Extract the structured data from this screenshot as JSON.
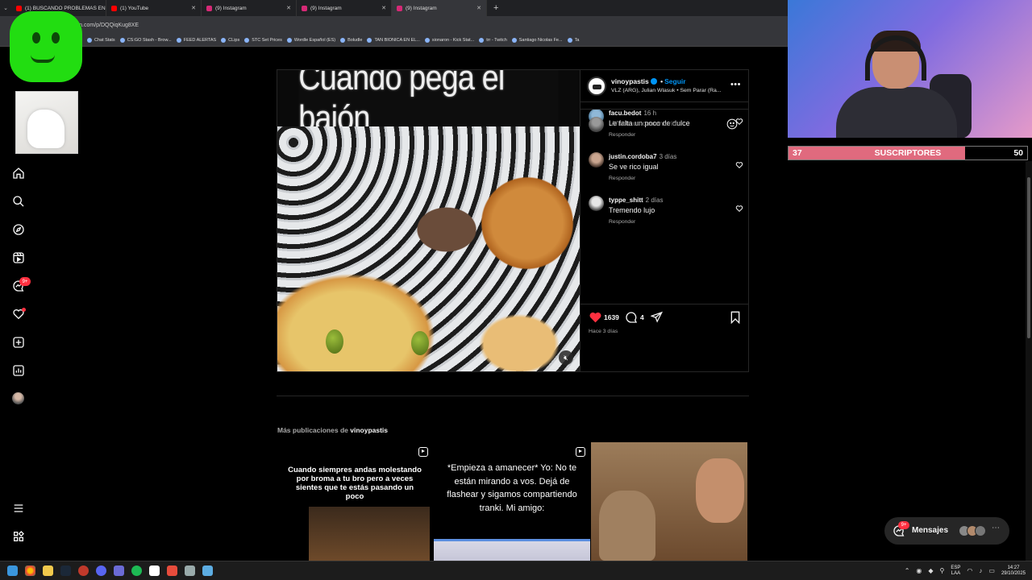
{
  "browser": {
    "tabs": [
      {
        "label": "(1) BUSCANDO PROBLEMAS EN",
        "color": "#ff0000"
      },
      {
        "label": "(1) YouTube",
        "color": "#ff0000"
      },
      {
        "label": "(9) Instagram",
        "color": "#d62976"
      },
      {
        "label": "(9) Instagram",
        "color": "#d62976"
      },
      {
        "label": "(9) Instagram",
        "color": "#d62976"
      }
    ],
    "url": "ram.com/p/DQQiqKug8XE",
    "bookmarks": [
      "Chat Stats",
      "CS:GO Stash - Brow...",
      "FEED ALERTAS",
      "CLips",
      "STC Set Prices",
      "Wordle Español (ES)",
      "Boludle",
      "TAN BIONICA EN EL...",
      "sionaron - Kick Stat...",
      "trr - Twitch",
      "Santiago Nicolas Fe...",
      "Ta"
    ]
  },
  "stream": {
    "subs_current": "37",
    "subs_label": "SUSCRIPTORES",
    "subs_goal": "50",
    "subs_progress": 0.74,
    "accent": "#e06a7e"
  },
  "sidebar": {
    "icons": [
      "home-icon",
      "search-icon",
      "explore-icon",
      "reels-icon",
      "messages-icon",
      "notifications-icon",
      "create-icon",
      "dashboard-icon",
      "profile-icon",
      "menu-icon",
      "apps-icon"
    ],
    "messages_badge": "9+"
  },
  "post": {
    "caption_overlay": "Cuando pega el bajón",
    "username": "vinoypastis",
    "follow": "Seguir",
    "separator": "•",
    "audio": "VLZ (ARG), Julian Wlasuk • Sem Parar (Ra...",
    "comments": [
      {
        "user": "facu.bedot",
        "time": "16 h",
        "text": "Le falta un poco de dulce",
        "reply": "Responder"
      },
      {
        "user": "justin.cordoba7",
        "time": "3 días",
        "text": "Se ve rico igual",
        "reply": "Responder"
      },
      {
        "user": "typpe_shitt",
        "time": "2 días",
        "text": "Tremendo lujo",
        "reply": "Responder"
      }
    ],
    "likes": "1639",
    "comment_count": "4",
    "posted": "Hace 3 días",
    "add_comment_placeholder": "Añade un comentario...",
    "like_color": "#ff3040"
  },
  "more_posts": {
    "label": "Más publicaciones de",
    "username": "vinoypastis",
    "thumbs": [
      {
        "text": "Cuando siempres andas molestando por broma a tu bro pero a veces sientes que te estás pasando un poco"
      },
      {
        "text": "*Empieza a amanecer* Yo: No te están mirando a vos. Dejá de flashear y sigamos compartiendo tranki. Mi amigo:"
      },
      {
        "text": ""
      }
    ]
  },
  "messages_button": {
    "label": "Mensajes",
    "badge": "9+"
  },
  "taskbar": {
    "lang_top": "ESP",
    "lang_bottom": "LAA",
    "time": "14:27",
    "date": "29/10/2025"
  }
}
